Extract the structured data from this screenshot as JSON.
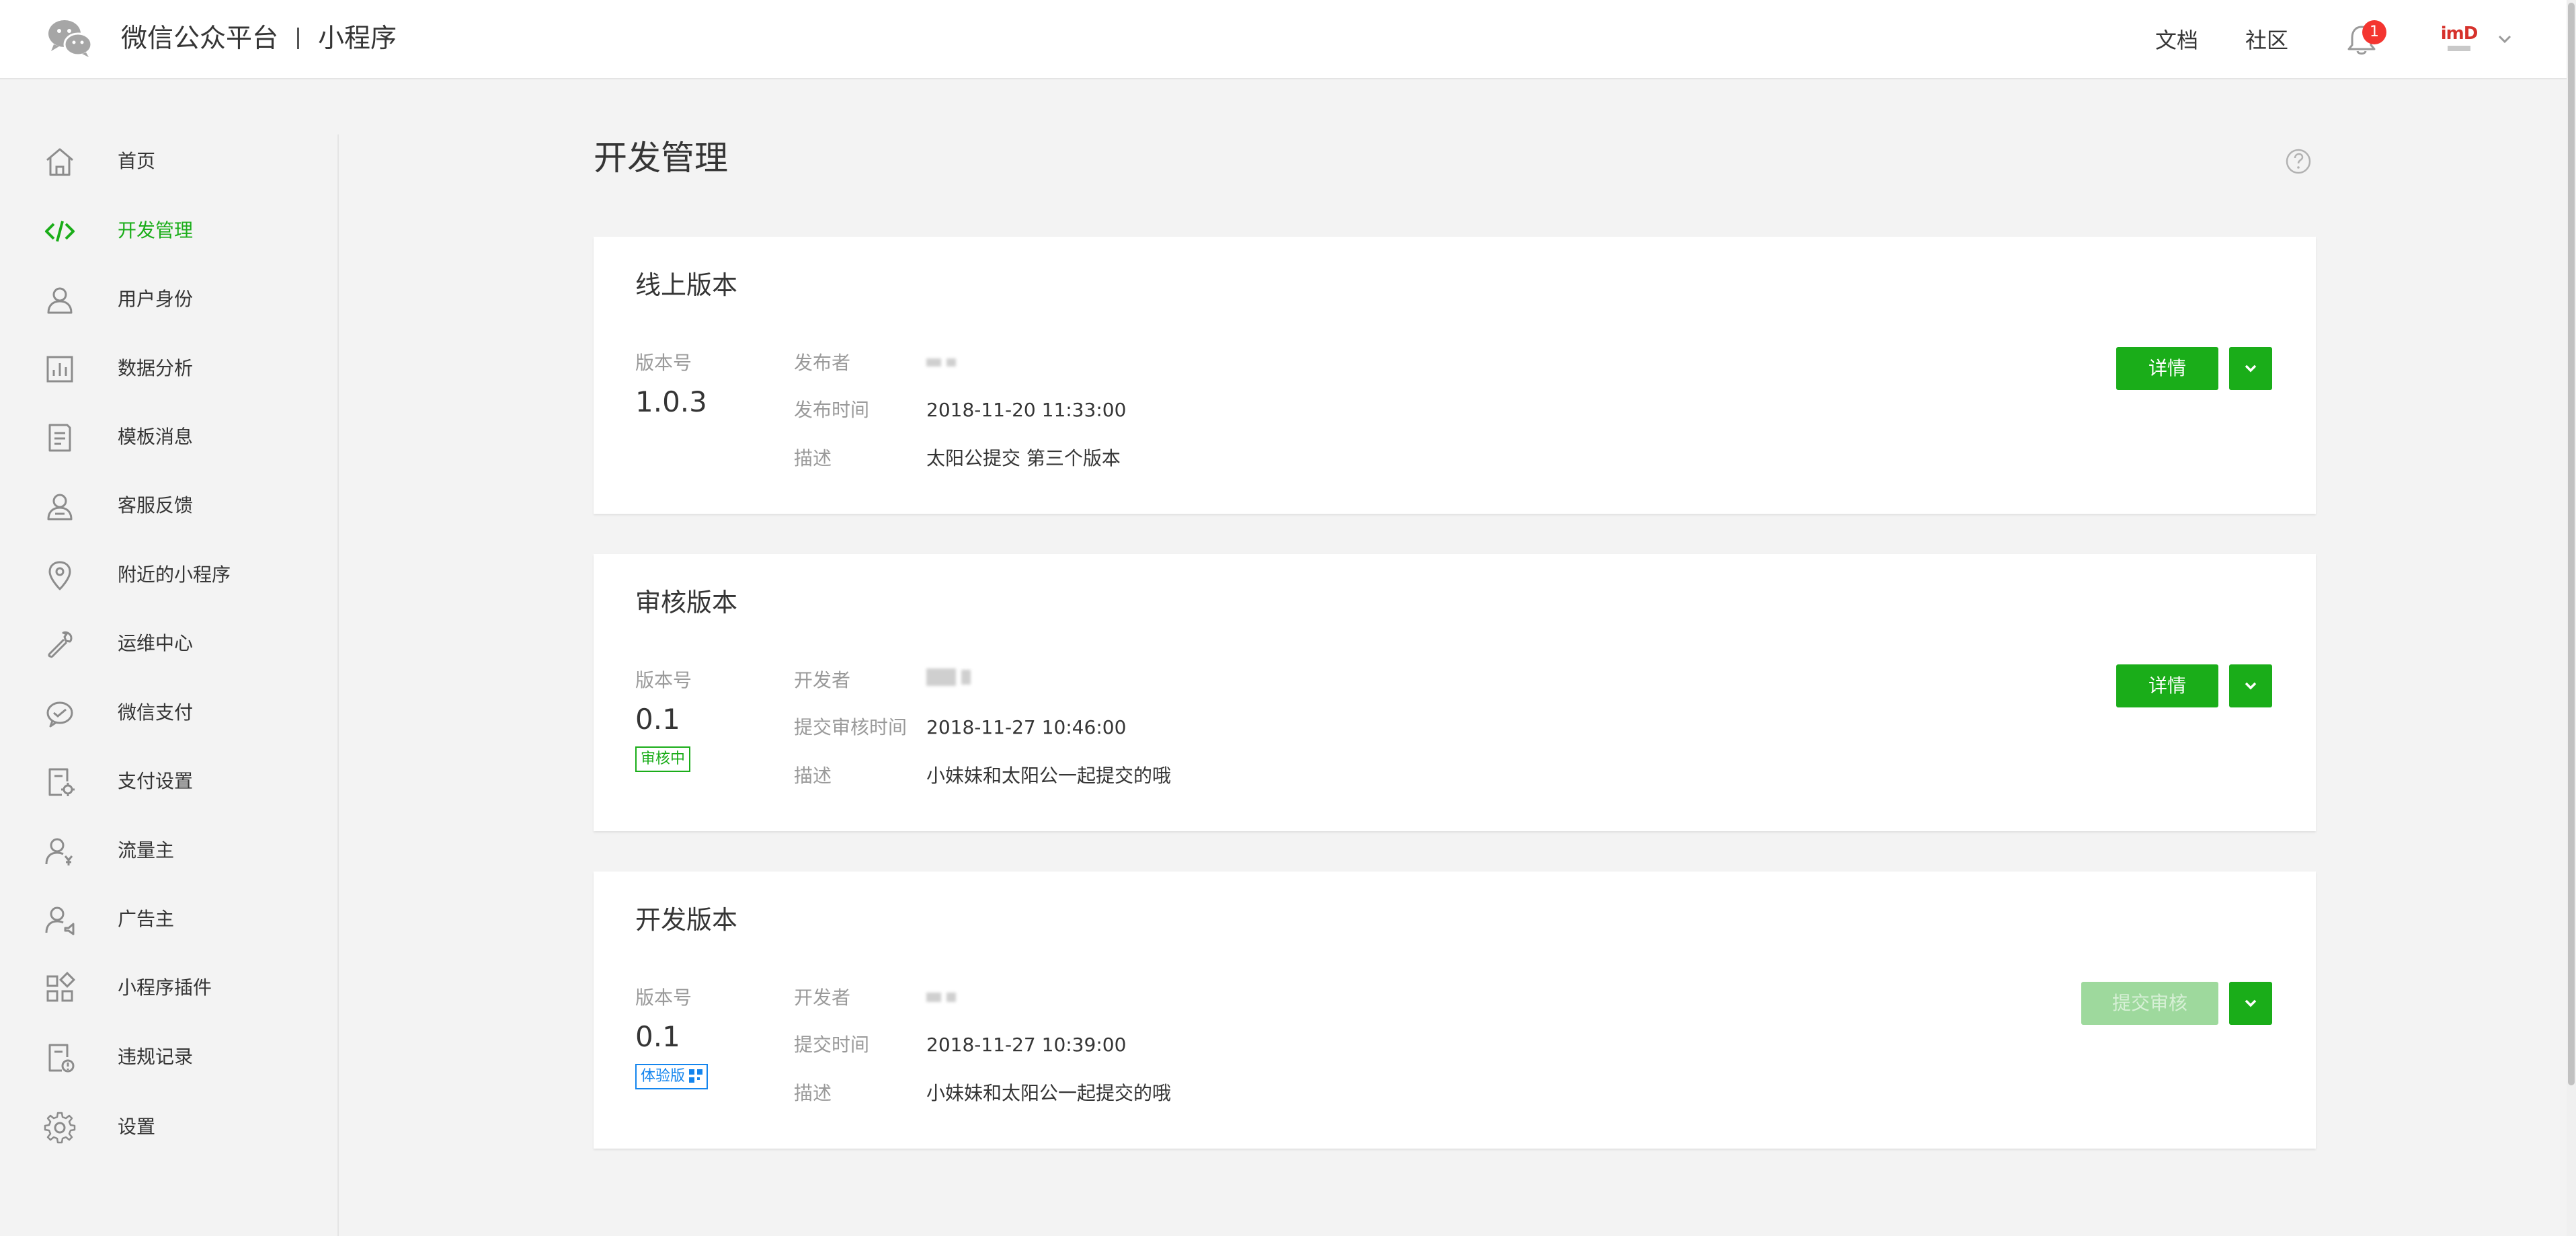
{
  "header": {
    "brand": "微信公众平台",
    "product": "小程序",
    "links": [
      "文档",
      "社区"
    ],
    "notification_count": "1",
    "avatar_text": "imD"
  },
  "sidebar": {
    "active_color": "#1aad19",
    "items": [
      {
        "label": "首页",
        "icon": "home-icon"
      },
      {
        "label": "开发管理",
        "icon": "code-icon",
        "active": true
      },
      {
        "label": "用户身份",
        "icon": "user-icon"
      },
      {
        "label": "数据分析",
        "icon": "bar-chart-icon"
      },
      {
        "label": "模板消息",
        "icon": "document-icon"
      },
      {
        "label": "客服反馈",
        "icon": "customer-service-icon"
      },
      {
        "label": "附近的小程序",
        "icon": "location-pin-icon"
      },
      {
        "label": "运维中心",
        "icon": "wrench-icon"
      },
      {
        "label": "微信支付",
        "icon": "wechat-pay-icon"
      },
      {
        "label": "支付设置",
        "icon": "payment-settings-icon"
      },
      {
        "label": "流量主",
        "icon": "traffic-owner-icon"
      },
      {
        "label": "广告主",
        "icon": "advertiser-icon"
      },
      {
        "label": "小程序插件",
        "icon": "plugin-grid-icon"
      },
      {
        "label": "违规记录",
        "icon": "violation-record-icon"
      },
      {
        "label": "设置",
        "icon": "gear-icon"
      }
    ]
  },
  "main": {
    "title": "开发管理",
    "cards": [
      {
        "title": "线上版本",
        "version_label": "版本号",
        "version": "1.0.3",
        "badge": null,
        "fields": [
          {
            "label": "发布者",
            "value": null
          },
          {
            "label": "发布时间",
            "value": "2018-11-20 11:33:00"
          },
          {
            "label": "描述",
            "value": "太阳公提交 第三个版本"
          }
        ],
        "primary_button": "详情",
        "primary_disabled": false
      },
      {
        "title": "审核版本",
        "version_label": "版本号",
        "version": "0.1",
        "badge": "审核中",
        "fields": [
          {
            "label": "开发者",
            "value": null
          },
          {
            "label": "提交审核时间",
            "value": "2018-11-27 10:46:00"
          },
          {
            "label": "描述",
            "value": "小妹妹和太阳公一起提交的哦"
          }
        ],
        "primary_button": "详情",
        "primary_disabled": false
      },
      {
        "title": "开发版本",
        "version_label": "版本号",
        "version": "0.1",
        "badge": "体验版",
        "fields": [
          {
            "label": "开发者",
            "value": null
          },
          {
            "label": "提交时间",
            "value": "2018-11-27 10:39:00"
          },
          {
            "label": "描述",
            "value": "小妹妹和太阳公一起提交的哦"
          }
        ],
        "primary_button": "提交审核",
        "primary_disabled": true
      }
    ]
  },
  "colors": {
    "primary_green": "#1aad19",
    "disabled_green": "#9ed99d",
    "badge_blue": "#1485ee",
    "notification_red": "#f43530"
  }
}
